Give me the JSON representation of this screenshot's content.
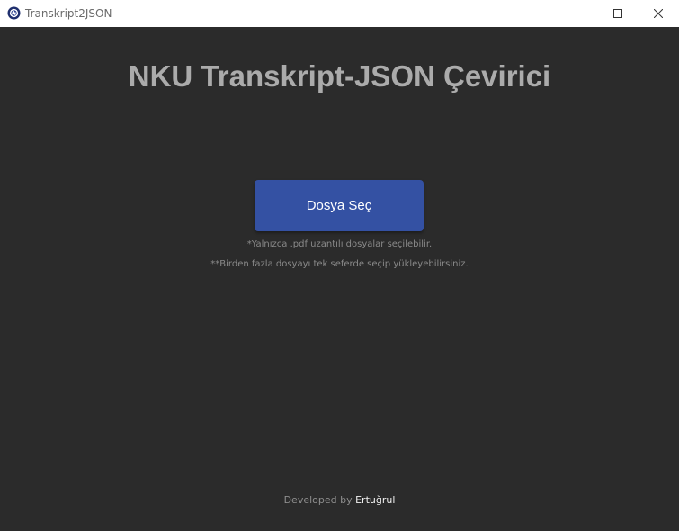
{
  "window": {
    "title": "Transkript2JSON",
    "app_icon": "globe-logo-icon",
    "controls": [
      "minimize-icon",
      "maximize-icon",
      "close-icon"
    ]
  },
  "main": {
    "heading": "NKU Transkript-JSON Çevirici",
    "select_button_label": "Dosya Seç",
    "note_pdf_only": "*Yalnızca .pdf uzantılı dosyalar seçilebilir.",
    "note_multiple": "**Birden fazla dosyayı tek seferde seçip yükleyebilirsiniz."
  },
  "footer": {
    "developed_by": "Developed by",
    "author": "Ertuğrul"
  },
  "colors": {
    "background": "#2b2b2b",
    "titlebar": "#ffffff",
    "accent_button": "#3451a3",
    "heading_text": "#ababab"
  }
}
